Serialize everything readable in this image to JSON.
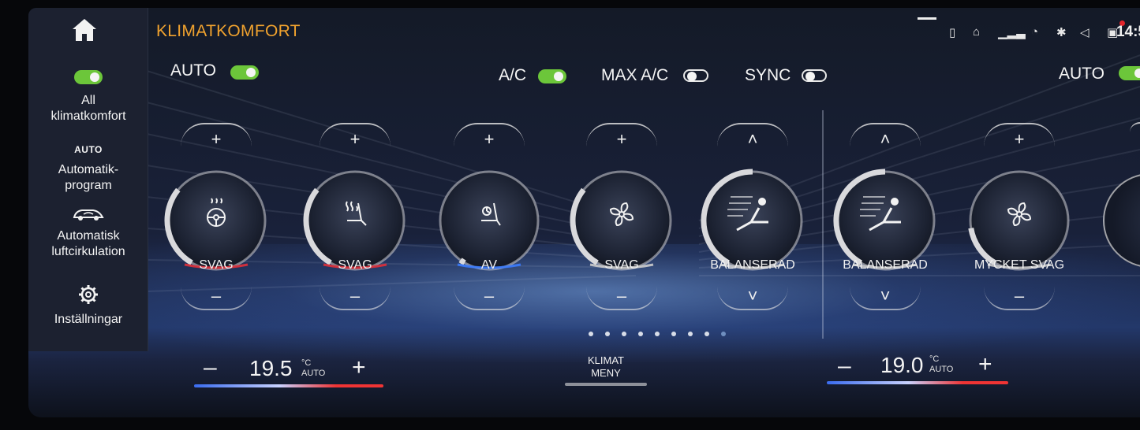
{
  "header": {
    "title": "KLIMATKOMFORT",
    "clock": "14:5"
  },
  "sidebar": {
    "items": [
      {
        "label": "All klimatkomfort",
        "line1": "All",
        "line2": "klimatkomfort",
        "toggle": "on"
      },
      {
        "badge": "AUTO",
        "line1": "Automatik-",
        "line2": "program"
      },
      {
        "line1": "Automatisk",
        "line2": "luftcirkulation"
      },
      {
        "line1": "Inställningar"
      }
    ]
  },
  "controls": {
    "auto_left": {
      "label": "AUTO",
      "state": "on"
    },
    "ac": {
      "label": "A/C",
      "state": "on"
    },
    "max_ac": {
      "label": "MAX A/C",
      "state": "off"
    },
    "sync": {
      "label": "SYNC",
      "state": "off"
    },
    "auto_right": {
      "label": "AUTO",
      "state": "on"
    }
  },
  "dials": [
    {
      "name": "steering-heat",
      "label": "SVAG",
      "up": "+",
      "down": "–",
      "icon": "steering-heat-icon",
      "accent": "#e0303a",
      "level": 0.33
    },
    {
      "name": "seat-heat-left",
      "label": "SVAG",
      "up": "+",
      "down": "–",
      "icon": "seat-heat-icon",
      "accent": "#e0303a",
      "level": 0.33
    },
    {
      "name": "seat-vent-left",
      "label": "AV",
      "up": "+",
      "down": "–",
      "icon": "seat-vent-icon",
      "accent": "#3a7bff",
      "level": 0.0
    },
    {
      "name": "fan-left",
      "label": "SVAG",
      "up": "+",
      "down": "–",
      "icon": "fan-icon",
      "accent": "#cccccc",
      "level": 0.33
    },
    {
      "name": "airflow-left",
      "label": "BALANSERAD",
      "up": "˄",
      "down": "˅",
      "icon": "airflow-person-icon",
      "accent": "#cccccc",
      "level": 0.5
    },
    {
      "name": "airflow-right",
      "label": "BALANSERAD",
      "up": "˄",
      "down": "˅",
      "icon": "airflow-person-icon",
      "accent": "#cccccc",
      "level": 0.5
    },
    {
      "name": "fan-right",
      "label": "MYCKET SVAG",
      "up": "+",
      "down": "–",
      "icon": "fan-icon",
      "accent": "#cccccc",
      "level": 0.17
    }
  ],
  "temperature": {
    "left": {
      "value": "19.5",
      "unit": "°C",
      "mode": "AUTO",
      "minus": "–",
      "plus": "+"
    },
    "right": {
      "value": "19.0",
      "unit": "°C",
      "mode": "AUTO",
      "minus": "–",
      "plus": "+"
    }
  },
  "menu": {
    "line1": "KLIMAT",
    "line2": "MENY"
  },
  "pagination": {
    "count": 9,
    "active": 8
  },
  "colors": {
    "accent": "#f0a22e",
    "toggle_on": "#6cc63a",
    "heat": "#e0303a",
    "cool": "#3a7bff"
  }
}
